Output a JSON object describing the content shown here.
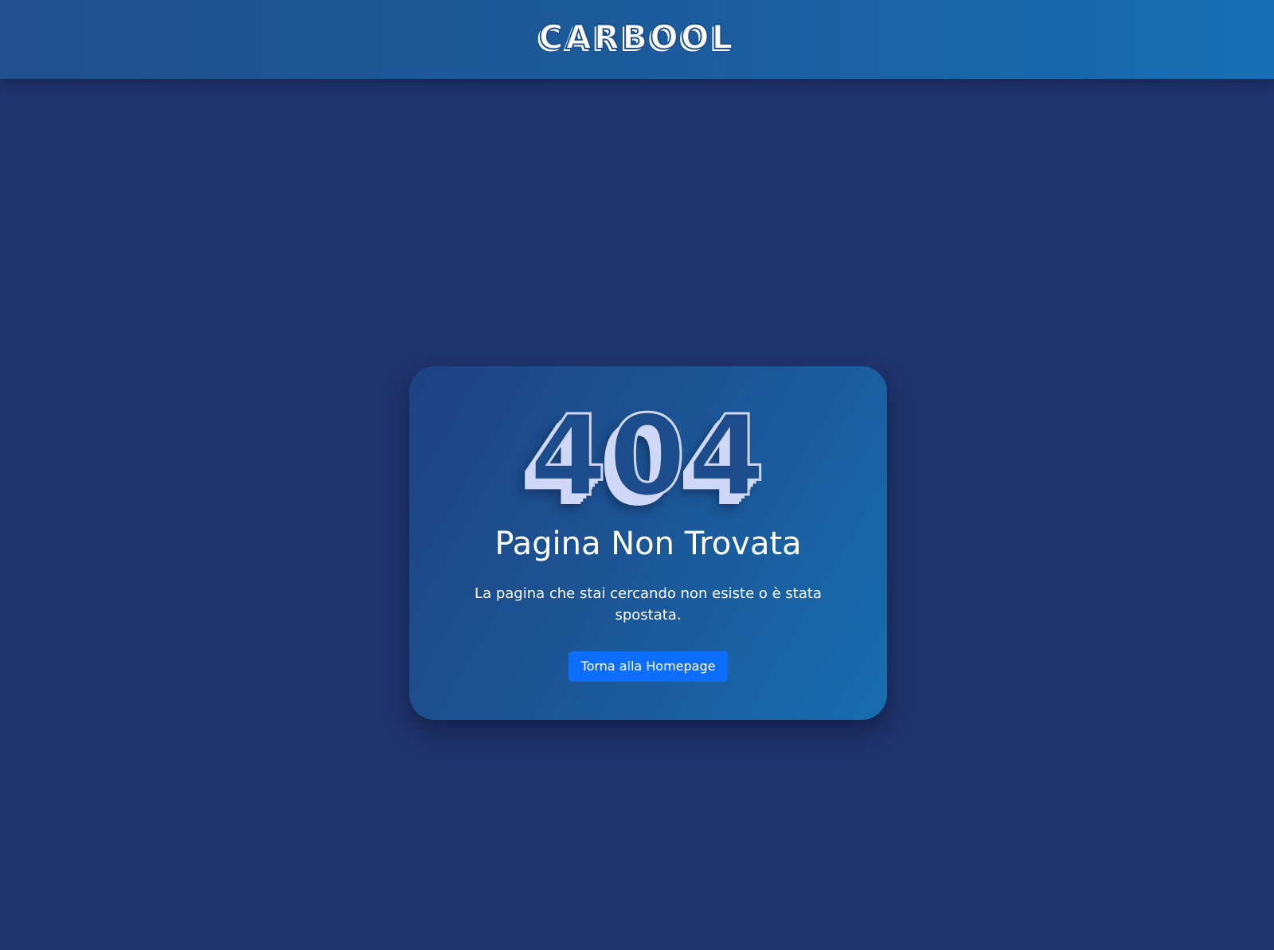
{
  "header": {
    "logo_text": "CARBOOL"
  },
  "error_card": {
    "code": "404",
    "title": "Pagina Non Trovata",
    "description": "La pagina che stai cercando non esiste o è stata spostata.",
    "home_button_label": "Torna alla Homepage"
  },
  "colors": {
    "page_background": "#20346d",
    "header_gradient_start": "#21508c",
    "header_gradient_end": "#176fb3",
    "card_gradient_start": "#1e4282",
    "card_gradient_end": "#176db0",
    "button_primary": "#0d6efd",
    "code_light": "#cfd8f6"
  }
}
